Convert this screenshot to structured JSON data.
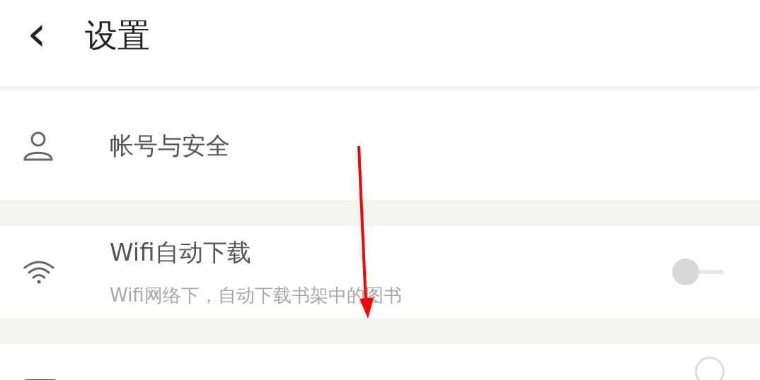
{
  "header": {
    "back_icon": "‹",
    "title": "设置"
  },
  "rows": [
    {
      "kind": "link",
      "title": "帐号与安全"
    },
    {
      "kind": "toggle",
      "title": "Wifi自动下载",
      "subtitle": "Wifi网络下，自动下载书架中的图书",
      "on": false
    },
    {
      "kind": "partial"
    }
  ],
  "overlay": {
    "kind": "arrow"
  }
}
